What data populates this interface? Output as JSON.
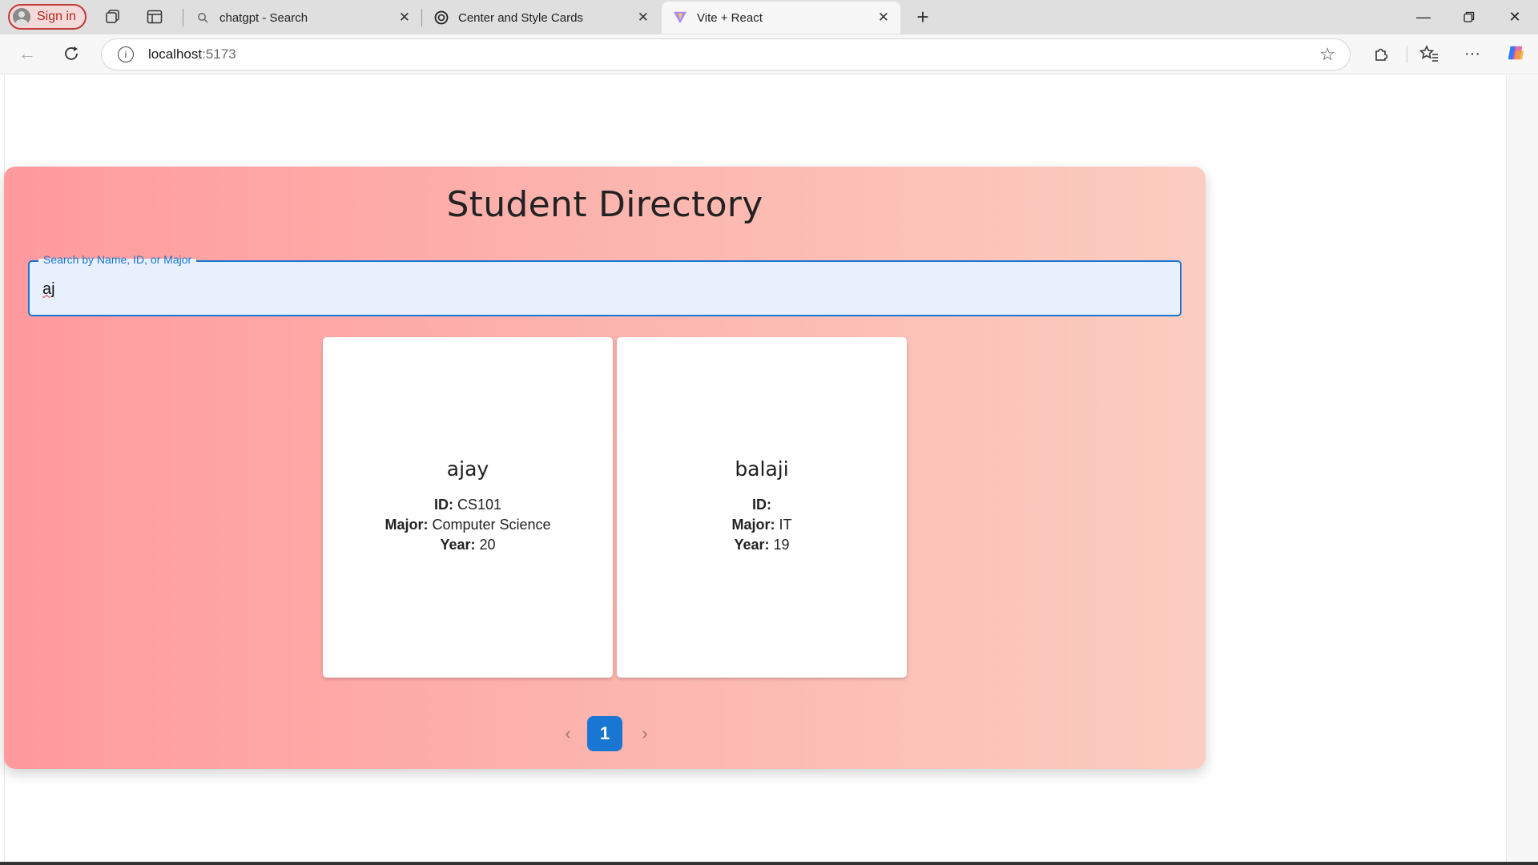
{
  "browser": {
    "signin_label": "Sign in",
    "tabs": [
      {
        "title": "chatgpt - Search",
        "icon": "search-icon"
      },
      {
        "title": "Center and Style Cards",
        "icon": "openai-icon"
      },
      {
        "title": "Vite + React",
        "icon": "vite-icon"
      }
    ],
    "url_host": "localhost",
    "url_port": ":5173"
  },
  "page": {
    "title": "Student Directory",
    "search": {
      "label": "Search by Name, ID, or Major",
      "value": "aj"
    },
    "students": [
      {
        "name": "ajay",
        "id_label": "ID:",
        "id": "CS101",
        "major_label": "Major:",
        "major": "Computer Science",
        "year_label": "Year:",
        "year": "20"
      },
      {
        "name": "balaji",
        "id_label": "ID:",
        "id": "",
        "major_label": "Major:",
        "major": "IT",
        "year_label": "Year:",
        "year": "19"
      }
    ],
    "pagination": {
      "current_page": "1"
    }
  },
  "colors": {
    "accent": "#1976d2",
    "gradient_start": "#ff9a9e",
    "gradient_end": "#fbcdc0"
  }
}
